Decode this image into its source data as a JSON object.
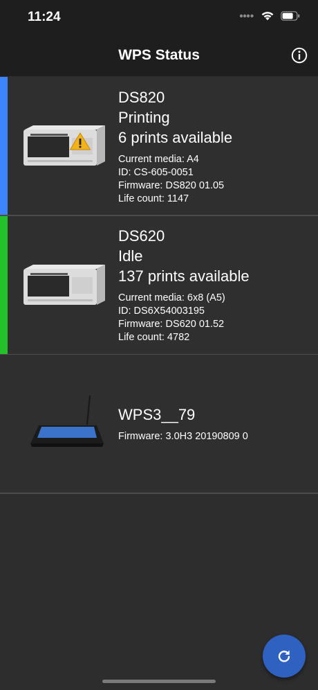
{
  "status_bar": {
    "time": "11:24",
    "icons": [
      "signal-dots-icon",
      "wifi-icon",
      "battery-icon"
    ]
  },
  "header": {
    "title": "WPS Status",
    "info_icon": "info-icon"
  },
  "devices": [
    {
      "name": "DS820",
      "state": "Printing",
      "prints": "6 prints available",
      "accent_color": "#3d85ff",
      "warning": true,
      "details": [
        "Current media: A4",
        "ID:  CS-605-0051",
        "Firmware: DS820 01.05",
        "Life count: 1147"
      ]
    },
    {
      "name": "DS620",
      "state": "Idle",
      "prints": "137 prints available",
      "accent_color": "#25c12a",
      "warning": false,
      "details": [
        "Current media: 6x8 (A5)",
        "ID:  DS6X54003195",
        "Firmware: DS620 01.52",
        "Life count: 4782"
      ]
    },
    {
      "name": "WPS3__79",
      "details": [
        "Firmware:  3.0H3 20190809 0"
      ]
    }
  ],
  "refresh_button": {
    "icon": "refresh-icon",
    "color": "#2f62c0"
  }
}
